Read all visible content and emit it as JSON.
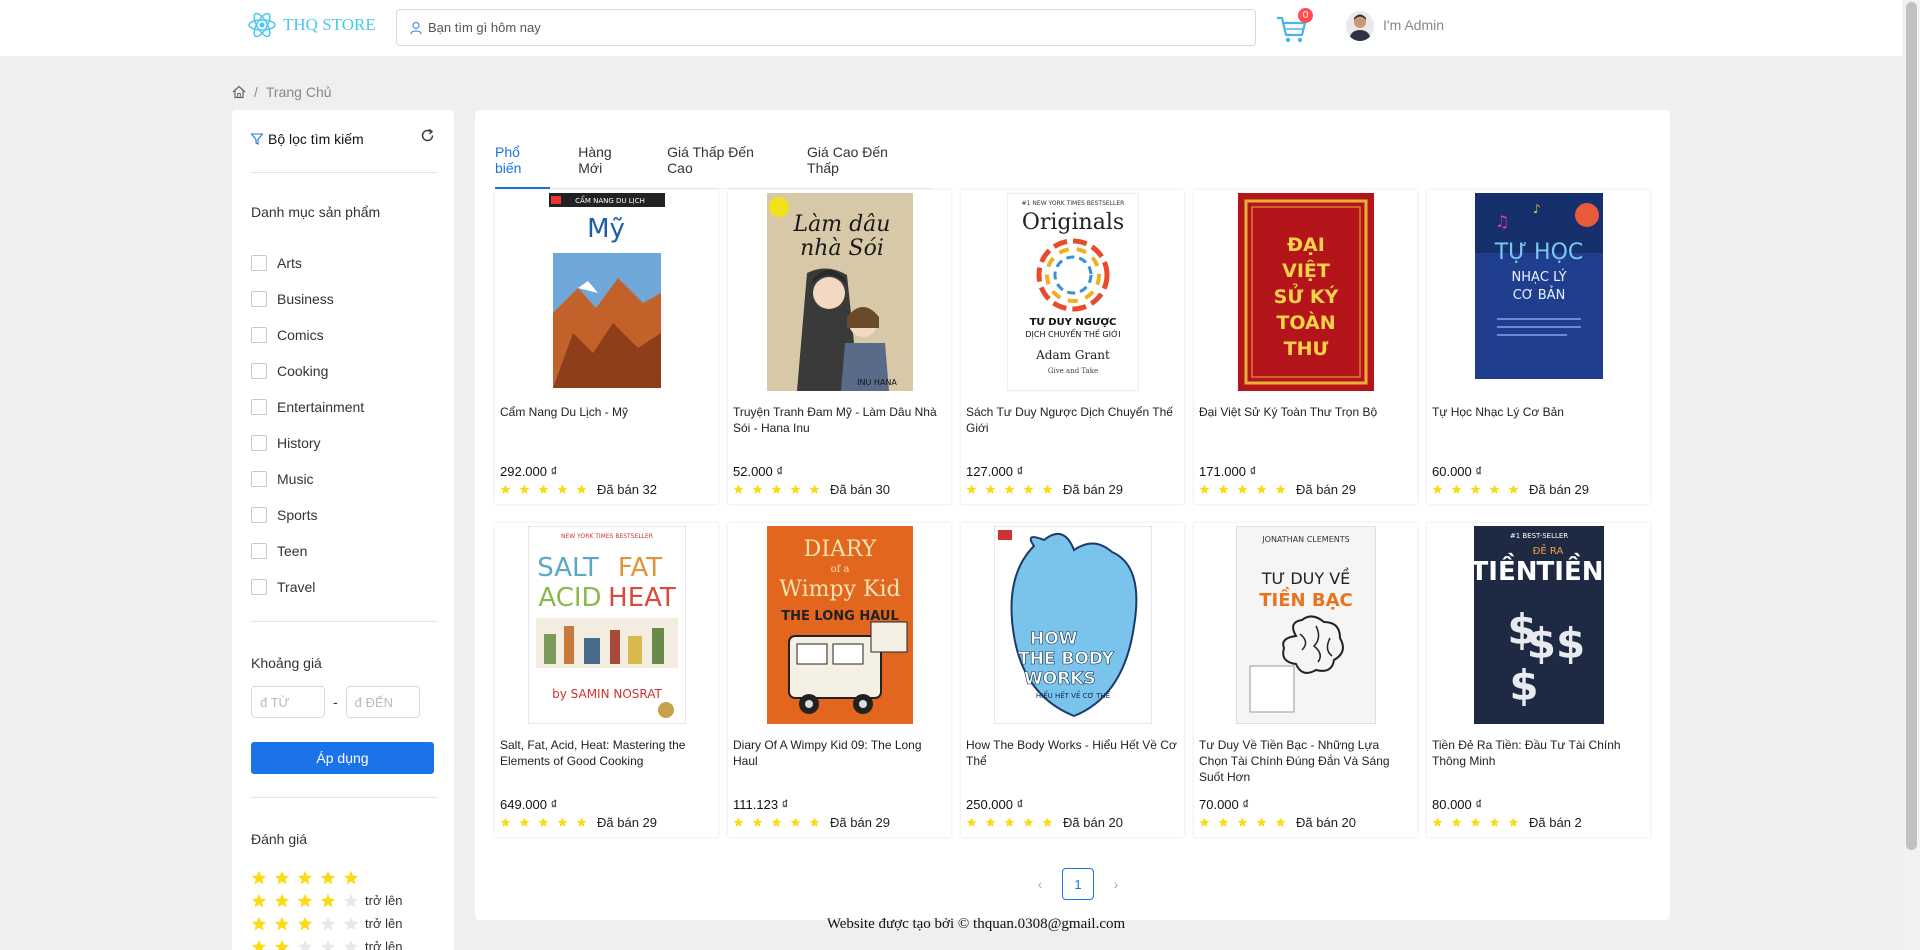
{
  "header": {
    "logo_text": "THQ STORE",
    "search_placeholder": "Bạn tìm gì hôm nay",
    "cart_count": "0",
    "admin_name": "I'm Admin"
  },
  "breadcrumb": {
    "home_label": "Trang Chủ"
  },
  "sidebar": {
    "filter_title": "Bộ lọc tìm kiếm",
    "category_title": "Danh mục sản phẩm",
    "categories": [
      "Arts",
      "Business",
      "Comics",
      "Cooking",
      "Entertainment",
      "History",
      "Music",
      "Sports",
      "Teen",
      "Travel"
    ],
    "price_title": "Khoảng giá",
    "price_from_placeholder": "đ TỪ",
    "price_to_placeholder": "đ ĐẾN",
    "price_dash": "-",
    "apply_label": "Áp dụng",
    "rating_title": "Đánh giá",
    "rating_suffix": "trở lên",
    "ratings": [
      5,
      4,
      3,
      2
    ]
  },
  "tabs": [
    "Phổ biến",
    "Hàng Mới",
    "Giá Thấp Đến Cao",
    "Giá Cao Đến Thấp"
  ],
  "products": [
    {
      "title": "Cẩm Nang Du Lịch - Mỹ",
      "price": "292.000 ₫",
      "sold": "Đã bán 32",
      "rating": 5,
      "cover_label": "Mỹ"
    },
    {
      "title": "Truyện Tranh Đam Mỹ - Làm Dâu Nhà Sói - Hana Inu",
      "price": "52.000 ₫",
      "sold": "Đã bán 30",
      "rating": 5,
      "cover_label": "Làm dâu nhà Sói"
    },
    {
      "title": "Sách Tư Duy Ngược Dịch Chuyển Thế Giới",
      "price": "127.000 ₫",
      "sold": "Đã bán 29",
      "rating": 5,
      "cover_label": "Originals"
    },
    {
      "title": "Đại Việt Sử Ký Toàn Thư Trọn Bộ",
      "price": "171.000 ₫",
      "sold": "Đã bán 29",
      "rating": 5,
      "cover_label": "ĐẠI VIỆT SỬ KÝ TOÀN THƯ"
    },
    {
      "title": "Tự Học Nhạc Lý Cơ Bản",
      "price": "60.000 ₫",
      "sold": "Đã bán 29",
      "rating": 5,
      "cover_label": "TỰ HỌC NHẠC LÝ CƠ BẢN"
    },
    {
      "title": "Salt, Fat, Acid, Heat: Mastering the Elements of Good Cooking",
      "price": "649.000 ₫",
      "sold": "Đã bán 29",
      "rating": 5,
      "cover_label": "SALT FAT ACID HEAT"
    },
    {
      "title": "Diary Of A Wimpy Kid 09: The Long Haul",
      "price": "111.123 ₫",
      "sold": "Đã bán 29",
      "rating": 5,
      "cover_label": "DIARY of a Wimpy Kid"
    },
    {
      "title": "How The Body Works - Hiểu Hết Về Cơ Thể",
      "price": "250.000 ₫",
      "sold": "Đã bán 20",
      "rating": 5,
      "cover_label": "HOW THE BODY WORKS"
    },
    {
      "title": "Tư Duy Về Tiền Bạc - Những Lựa Chọn Tài Chính Đúng Đắn Và Sáng Suốt Hơn",
      "price": "70.000 ₫",
      "sold": "Đã bán 20",
      "rating": 5,
      "cover_label": "TƯ DUY VỀ TIỀN BẠC"
    },
    {
      "title": "Tiền Đẻ Ra Tiền: Đầu Tư Tài Chính Thông Minh",
      "price": "80.000 ₫",
      "sold": "Đã bán 2",
      "rating": 5,
      "cover_label": "TIỀN ĐẺ RA TIỀN"
    }
  ],
  "pagination": {
    "prev": "‹",
    "current": "1",
    "next": "›"
  },
  "footer": {
    "text": "Website được tạo bởi © thquan.0308@gmail.com"
  },
  "colors": {
    "accent": "#1a73e8",
    "star": "#fadb14",
    "logo": "#48c8f0",
    "badge": "#ff4d4f"
  }
}
